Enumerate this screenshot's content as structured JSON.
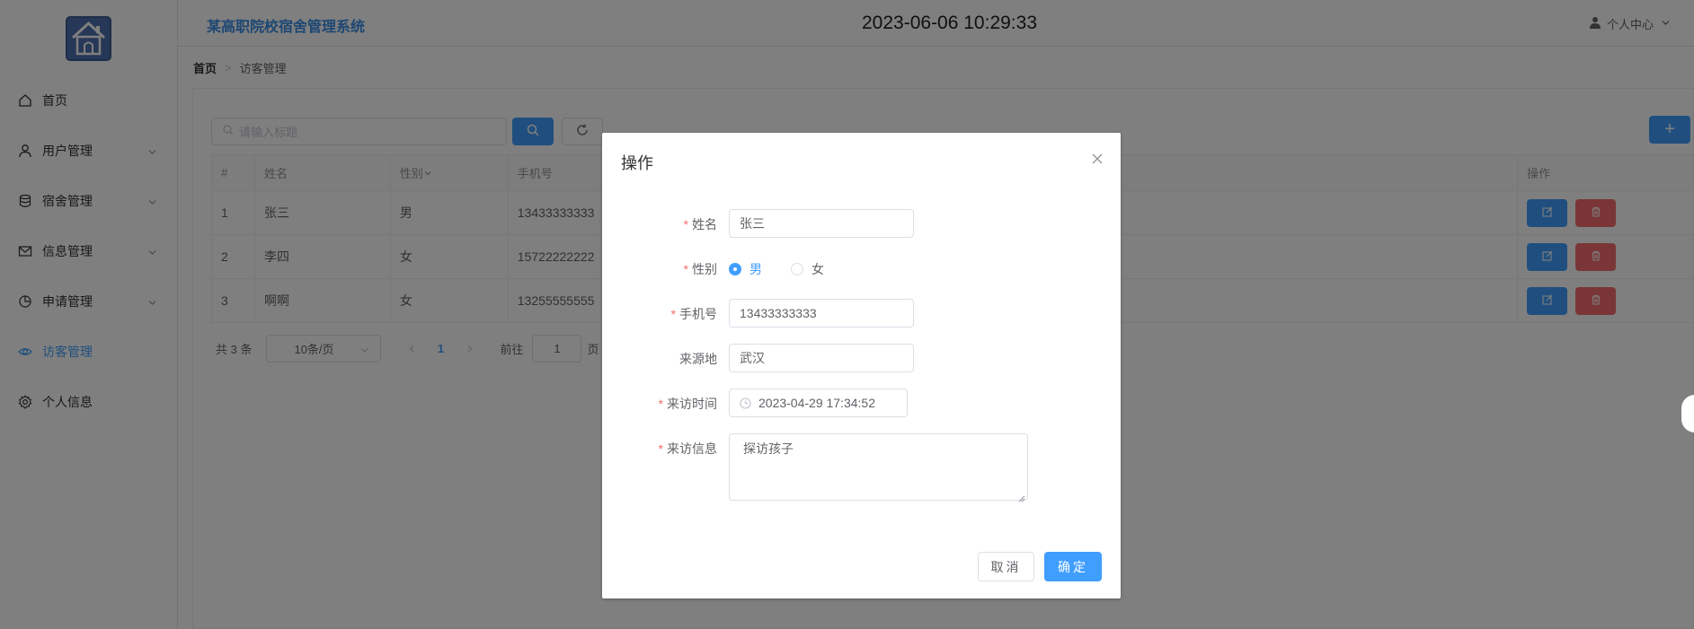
{
  "header": {
    "app_title": "某高职院校宿舍管理系统",
    "datetime": "2023-06-06 10:29:33",
    "user_center": "个人中心"
  },
  "sidebar": {
    "items": [
      {
        "label": "首页",
        "icon": "home-icon",
        "has_submenu": false
      },
      {
        "label": "用户管理",
        "icon": "user-icon",
        "has_submenu": true
      },
      {
        "label": "宿舍管理",
        "icon": "database-icon",
        "has_submenu": true
      },
      {
        "label": "信息管理",
        "icon": "mail-icon",
        "has_submenu": true
      },
      {
        "label": "申请管理",
        "icon": "pie-chart-icon",
        "has_submenu": true
      },
      {
        "label": "访客管理",
        "icon": "eye-icon",
        "has_submenu": false,
        "active": true
      },
      {
        "label": "个人信息",
        "icon": "gear-icon",
        "has_submenu": false
      }
    ]
  },
  "breadcrumb": {
    "home": "首页",
    "separator": ">",
    "current": "访客管理"
  },
  "search": {
    "placeholder": "请输入标题",
    "add_label": "+"
  },
  "table": {
    "columns": [
      "#",
      "姓名",
      "性别",
      "手机号",
      "操作"
    ],
    "rows": [
      {
        "id": "1",
        "name": "张三",
        "gender": "男",
        "phone": "13433333333"
      },
      {
        "id": "2",
        "name": "李四",
        "gender": "女",
        "phone": "15722222222"
      },
      {
        "id": "3",
        "name": "啊啊",
        "gender": "女",
        "phone": "13255555555"
      }
    ]
  },
  "pagination": {
    "total": "共 3 条",
    "page_size": "10条/页",
    "current_page": "1",
    "goto_label": "前往",
    "goto_value": "1",
    "page_unit": "页"
  },
  "dialog": {
    "title": "操作",
    "fields": {
      "name": {
        "label": "姓名",
        "value": "张三",
        "required": true
      },
      "gender": {
        "label": "性别",
        "options": [
          "男",
          "女"
        ],
        "selected": "男",
        "required": true
      },
      "phone": {
        "label": "手机号",
        "value": "13433333333",
        "required": true
      },
      "origin": {
        "label": "来源地",
        "value": "武汉",
        "required": false
      },
      "visit_time": {
        "label": "来访时间",
        "value": "2023-04-29 17:34:52",
        "required": true
      },
      "visit_info": {
        "label": "来访信息",
        "value": "探访孩子",
        "required": true
      }
    },
    "cancel_label": "取消",
    "ok_label": "确定"
  },
  "colors": {
    "primary": "#409eff",
    "danger": "#f56c6c",
    "title_blue": "#3a8ee6",
    "required": "#f56c6c"
  }
}
